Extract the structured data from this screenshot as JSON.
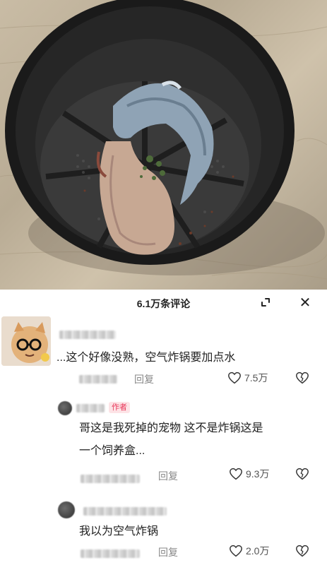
{
  "panel": {
    "title": "6.1万条评论"
  },
  "comments": [
    {
      "text": "...这个好像没熟，空气炸锅要加点水",
      "reply_label": "回复",
      "likes": "7.5万"
    },
    {
      "badge": "作者",
      "text_line1": "哥这是我死掉的宠物 这不是炸锅这是",
      "text_line2": "一个饲养盒...",
      "reply_label": "回复",
      "likes": "9.3万"
    },
    {
      "text": "我以为空气炸锅",
      "reply_label": "回复",
      "likes": "2.0万"
    }
  ],
  "icons": {
    "expand": "expand-icon",
    "close": "close-icon",
    "like": "heart-icon",
    "dislike": "broken-heart-icon"
  },
  "colors": {
    "author_badge_bg": "#fde3e6",
    "author_badge_text": "#e8385a"
  }
}
